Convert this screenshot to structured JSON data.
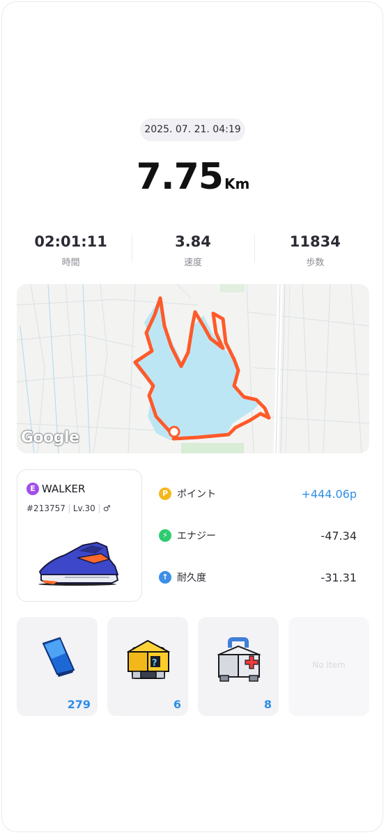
{
  "session": {
    "datetime": "2025. 07. 21. 04:19",
    "distance_value": "7.75",
    "distance_unit": "Km"
  },
  "stats": [
    {
      "value": "02:01:11",
      "label": "時間"
    },
    {
      "value": "3.84",
      "label": "速度"
    },
    {
      "value": "11834",
      "label": "歩数"
    }
  ],
  "map": {
    "attribution": "Google",
    "route_color": "#ff5a2a",
    "water_color": "#bde6f5"
  },
  "sneaker": {
    "badge": "E",
    "type": "WALKER",
    "id": "#213757",
    "level": "Lv.30",
    "gender_symbol": "♂"
  },
  "rewards": [
    {
      "icon": "P",
      "label": "ポイント",
      "value": "+444.06p",
      "color": "#f5b81c"
    },
    {
      "icon": "⚡",
      "label": "エナジー",
      "value": "-47.34",
      "color": "#2ecb6f"
    },
    {
      "icon": "↑",
      "label": "耐久度",
      "value": "-31.31",
      "color": "#3d8fe8"
    }
  ],
  "items": [
    {
      "name": "blue-gem",
      "count": "279"
    },
    {
      "name": "mystery-box",
      "count": "6"
    },
    {
      "name": "repair-kit",
      "count": "8"
    }
  ],
  "empty_slot_label": "No Item",
  "colors": {
    "accent": "#2e8ee6",
    "pill": "#f1f1f5"
  }
}
